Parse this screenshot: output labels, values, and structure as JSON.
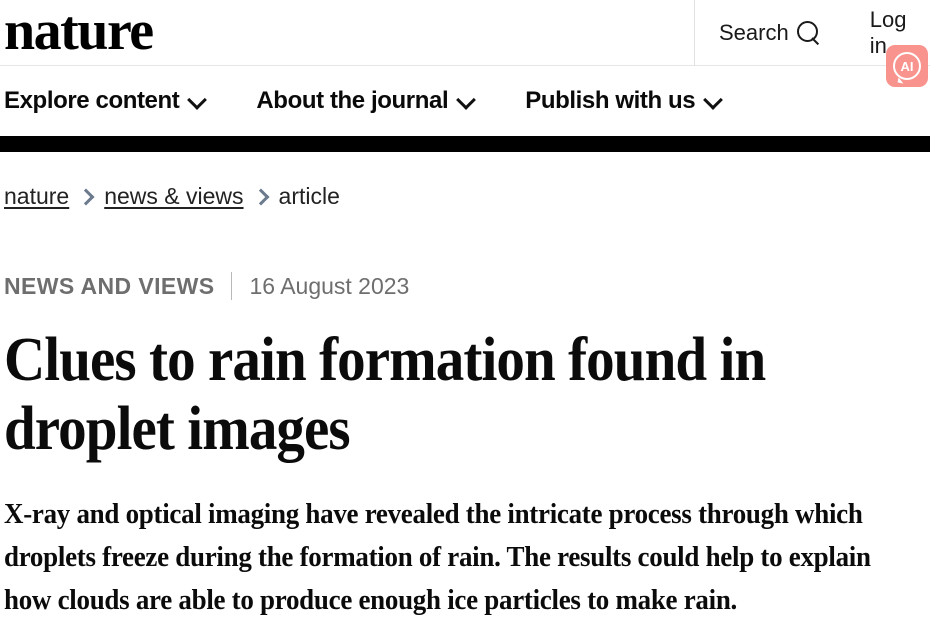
{
  "header": {
    "logo_text": "nature",
    "search_label": "Search",
    "search_icon": "search-icon",
    "login_label": "Log in",
    "ai_badge": {
      "label": "AI",
      "icon": "ai-speech-bubble-icon",
      "color": "#f9938d"
    }
  },
  "nav": {
    "items": [
      {
        "label": "Explore content",
        "icon": "chevron-down-icon"
      },
      {
        "label": "About the journal",
        "icon": "chevron-down-icon"
      },
      {
        "label": "Publish with us",
        "icon": "chevron-down-icon"
      }
    ]
  },
  "breadcrumb": {
    "items": [
      {
        "label": "nature",
        "is_link": true
      },
      {
        "label": "news & views",
        "is_link": true
      },
      {
        "label": "article",
        "is_link": false
      }
    ],
    "separator_icon": "chevron-right-icon"
  },
  "article": {
    "kicker": "NEWS AND VIEWS",
    "date": "16 August 2023",
    "headline": "Clues to rain formation found in droplet images",
    "standfirst": "X-ray and optical imaging have revealed the intricate process through which droplets freeze during the formation of rain. The results could help to explain how clouds are able to produce enough ice particles to make rain."
  },
  "colors": {
    "accent_ai": "#f9938d",
    "rule_black": "#000000",
    "meta_gray": "#6e6e6e",
    "chevron_blue_gray": "#6b7a8d"
  }
}
